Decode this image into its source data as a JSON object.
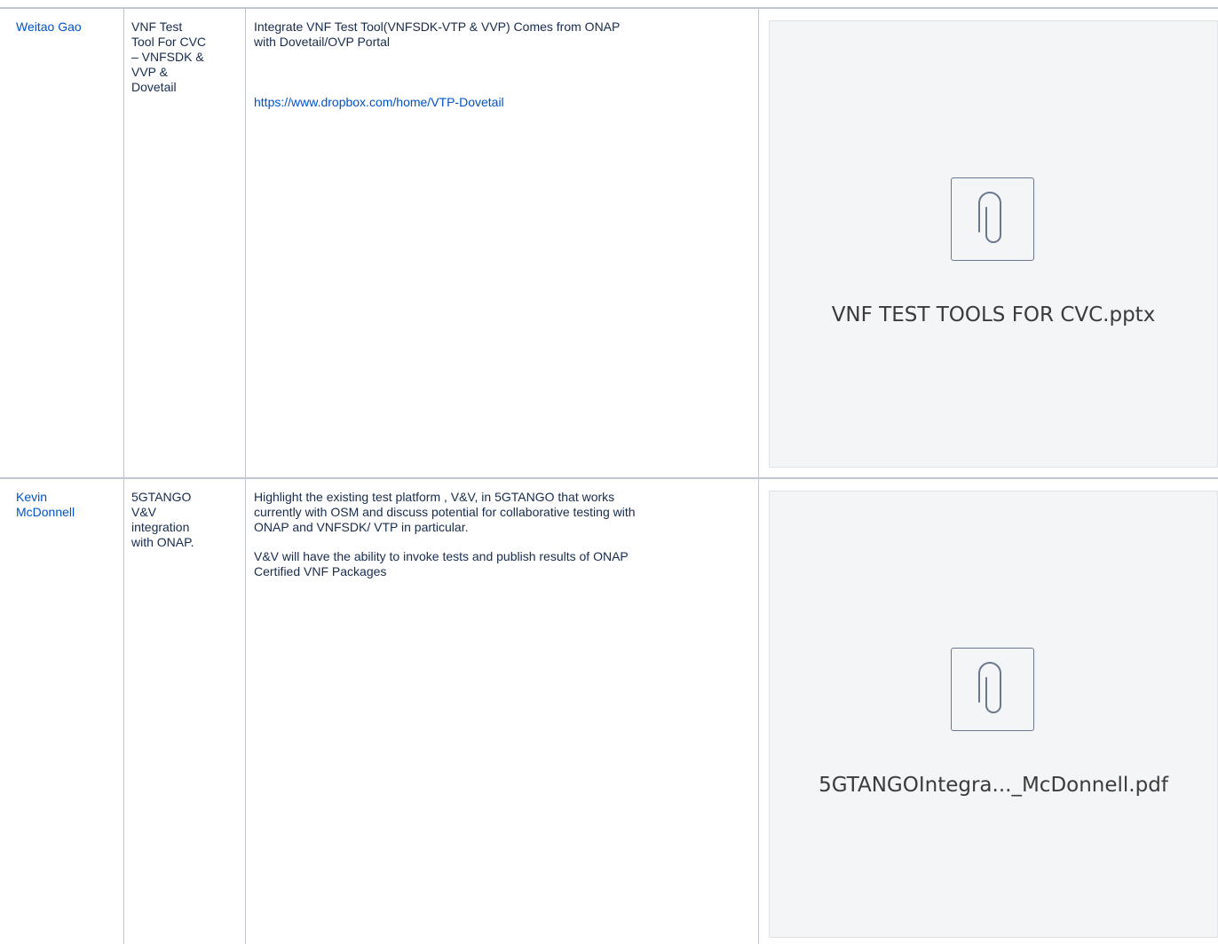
{
  "rows": [
    {
      "presenter": "Weitao Gao",
      "topic_lines": [
        "VNF Test",
        "Tool For CVC",
        "– VNFSDK &",
        "VVP &",
        "Dovetail"
      ],
      "description_lines": [
        "Integrate VNF Test Tool(VNFSDK-VTP & VVP) Comes from ONAP",
        "with Dovetail/OVP Portal"
      ],
      "link": "https://www.dropbox.com/home/VTP-Dovetail",
      "attachment": {
        "filename": "VNF TEST TOOLS FOR CVC.pptx",
        "icon": "paperclip-icon"
      }
    },
    {
      "presenter_lines": [
        "Kevin",
        "McDonnell"
      ],
      "topic_lines": [
        "5GTANGO",
        "V&V",
        "integration",
        "with ONAP."
      ],
      "paragraph1_lines": [
        "Highlight the existing test platform , V&V, in 5GTANGO that works",
        "currently with OSM and discuss potential for collaborative testing with",
        "ONAP and VNFSDK/ VTP in particular."
      ],
      "paragraph2_lines": [
        "V&V will have the ability to invoke tests and publish results of ONAP",
        "Certified VNF Packages"
      ],
      "attachment": {
        "filename": "5GTANGOIntegra..._McDonnell.pdf",
        "icon": "paperclip-icon"
      }
    }
  ],
  "colors": {
    "link": "#0052cc",
    "text": "#172b4d",
    "border": "#c1c7d0",
    "preview_bg": "#f4f5f7"
  }
}
